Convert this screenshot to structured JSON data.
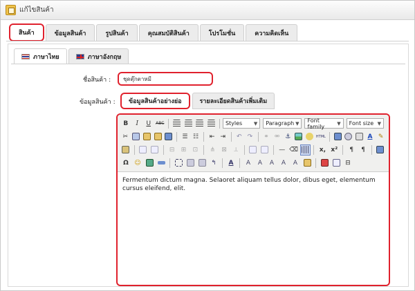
{
  "window": {
    "title": "แก้ไขสินค้า"
  },
  "main_tabs": [
    {
      "label": "สินค้า",
      "active": true
    },
    {
      "label": "ข้อมูลสินค้า"
    },
    {
      "label": "รูปสินค้า"
    },
    {
      "label": "คุณสมบัติสินค้า"
    },
    {
      "label": "โปรโมชั่น"
    },
    {
      "label": "ความคิดเห็น"
    }
  ],
  "lang_tabs": [
    {
      "label": "ภาษาไทย",
      "active": true,
      "flag": "thai-flag-icon"
    },
    {
      "label": "ภาษาอังกฤษ",
      "flag": "uk-flag-icon"
    }
  ],
  "form": {
    "name_label": "ชื่อสินค้า :",
    "name_value": "ชุดตุ๊กตาหมี",
    "info_label": "ข้อมูลสินค้า :"
  },
  "info_tabs": [
    {
      "label": "ข้อมูลสินค้าอย่างย่อ",
      "active": true
    },
    {
      "label": "รายละเอียดสินค้าเพิ่มเติม"
    }
  ],
  "editor": {
    "bold": "B",
    "italic": "I",
    "underline": "U",
    "strike": "ABC",
    "styles": "Styles",
    "format": "Paragraph",
    "font_family": "Font family",
    "font_size": "Font size",
    "content": "Fermentum dictum magna. Selaoret aliquam tellus dolor, dibus eget, elementum cursus eleifend, elit."
  },
  "colors": {
    "accent": "#e0212d"
  }
}
